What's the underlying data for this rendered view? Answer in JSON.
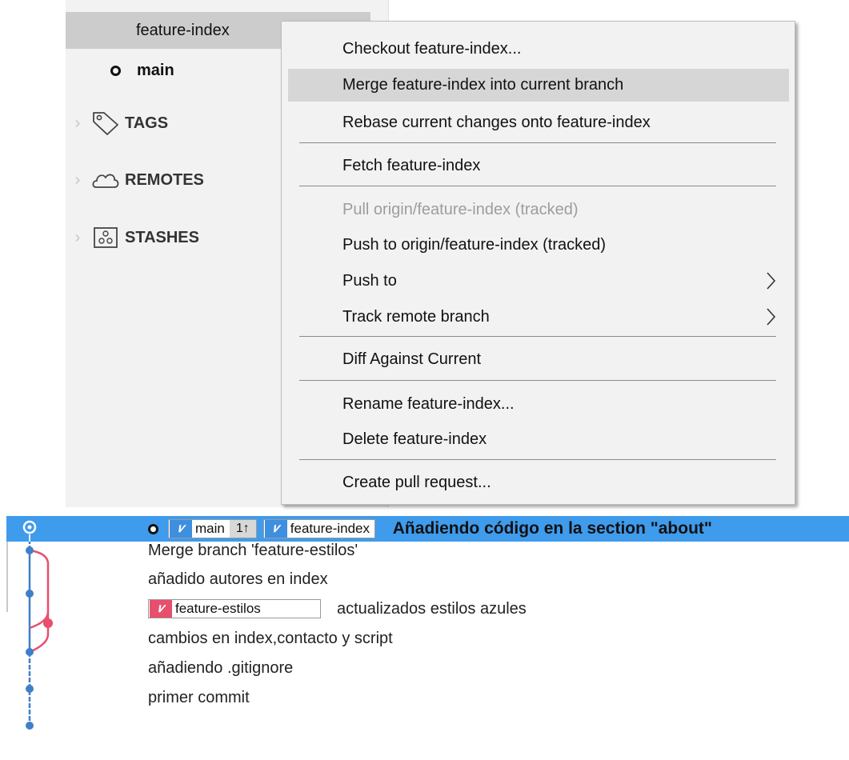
{
  "sidebar": {
    "branches": [
      {
        "label": "feature-index"
      },
      {
        "label": "main"
      }
    ],
    "sections": {
      "tags": "TAGS",
      "remotes": "REMOTES",
      "stashes": "STASHES"
    }
  },
  "context_menu": {
    "items": [
      {
        "label": "Checkout feature-index..."
      },
      {
        "label": "Merge feature-index into current branch",
        "state": "hover"
      },
      {
        "label": "Rebase current changes onto feature-index"
      },
      {
        "label": "Fetch feature-index"
      },
      {
        "label": "Pull origin/feature-index (tracked)",
        "state": "disabled"
      },
      {
        "label": "Push to origin/feature-index (tracked)"
      },
      {
        "label": "Push to",
        "submenu": true
      },
      {
        "label": "Track remote branch",
        "submenu": true
      },
      {
        "label": "Diff Against Current"
      },
      {
        "label": "Rename feature-index..."
      },
      {
        "label": "Delete feature-index"
      },
      {
        "label": "Create pull request..."
      }
    ]
  },
  "history": {
    "head_row": {
      "main_ref": "main",
      "ahead_count": "1↑",
      "feature_ref": "feature-index",
      "message": "Añadiendo código en la section \"about\""
    },
    "commits": [
      {
        "message": "Merge branch 'feature-estilos'"
      },
      {
        "message": "añadido autores en index"
      },
      {
        "ref": "feature-estilos",
        "message": "actualizados estilos azules"
      },
      {
        "message": "cambios en index,contacto y script"
      },
      {
        "message": "añadiendo .gitignore"
      },
      {
        "message": "primer commit"
      }
    ]
  },
  "colors": {
    "selection": "#3f9bec",
    "main_line": "#3e7fc9",
    "branch_line": "#e84f6c",
    "menu_bg": "#f2f2f2",
    "menu_hover": "#d6d6d6"
  }
}
